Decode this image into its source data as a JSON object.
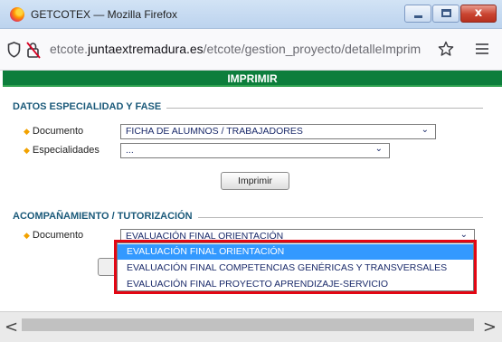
{
  "window": {
    "title": "GETCOTEX — Mozilla Firefox",
    "close_glyph": "x",
    "icons": {
      "logo": "firefox-logo-icon",
      "minimize": "minimize-icon",
      "maximize": "maximize-icon",
      "close": "close-icon"
    }
  },
  "urlbar": {
    "url_prefix": "etcote.",
    "url_domain": "juntaextremadura.es",
    "url_path": "/etcote/gestion_proyecto/detalleImprim",
    "icons": {
      "tracking": "shield-icon",
      "security": "lock-icon",
      "bookmark": "star-icon",
      "menu": "hamburger-menu-icon"
    }
  },
  "page": {
    "header_title": "IMPRIMIR",
    "colors": {
      "header_bg": "#0d7e3c",
      "legend_text": "#1b5a7a",
      "bullet": "#f2a200",
      "selection": "#3399ff",
      "highlight_box": "#e30613"
    },
    "section_especialidad": {
      "legend": "DATOS ESPECIALIDAD Y FASE",
      "documento_label": "Documento",
      "documento_value": "FICHA DE ALUMNOS / TRABAJADORES",
      "especialidades_label": "Especialidades",
      "especialidades_value": "...",
      "print_button": "Imprimir"
    },
    "section_tutorizacion": {
      "legend": "ACOMPAÑAMIENTO / TUTORIZACIÓN",
      "documento_label": "Documento",
      "documento_value": "EVALUACIÓN FINAL ORIENTACIÓN",
      "dropdown_options": [
        "EVALUACIÓN FINAL ORIENTACIÓN",
        "EVALUACIÓN FINAL COMPETENCIAS GENÉRICAS Y TRANSVERSALES",
        "EVALUACIÓN FINAL PROYECTO APRENDIZAJE-SERVICIO"
      ],
      "selected_option_index": 0
    }
  },
  "scrollbar": {
    "left_arrow": "<",
    "right_arrow": ">"
  }
}
